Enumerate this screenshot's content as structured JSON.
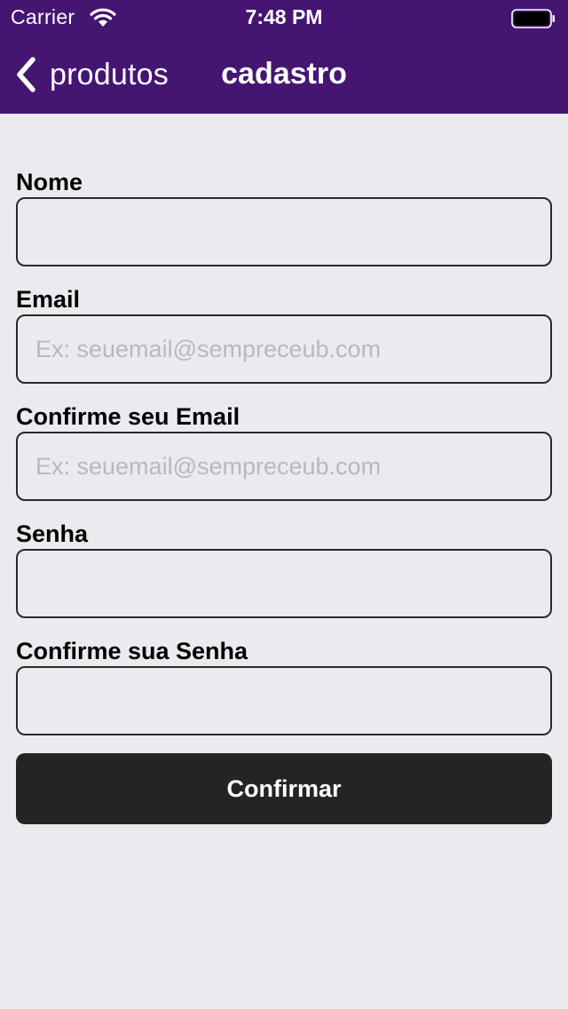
{
  "status_bar": {
    "carrier": "Carrier",
    "time": "7:48 PM",
    "wifi_icon": "wifi-icon",
    "battery_icon": "battery-full-icon"
  },
  "nav_bar": {
    "back_label": "produtos",
    "back_icon": "chevron-left-icon",
    "title": "cadastro",
    "background_color": "#441672"
  },
  "form": {
    "fields": [
      {
        "label": "Nome",
        "value": "",
        "placeholder": ""
      },
      {
        "label": "Email",
        "value": "",
        "placeholder": "Ex: seuemail@sempreceub.com"
      },
      {
        "label": "Confirme seu Email",
        "value": "",
        "placeholder": "Ex: seuemail@sempreceub.com"
      },
      {
        "label": "Senha",
        "value": "",
        "placeholder": ""
      },
      {
        "label": "Confirme sua Senha",
        "value": "",
        "placeholder": ""
      }
    ],
    "submit_label": "Confirmar"
  },
  "colors": {
    "background": "#ebeaef",
    "button": "#242424"
  }
}
